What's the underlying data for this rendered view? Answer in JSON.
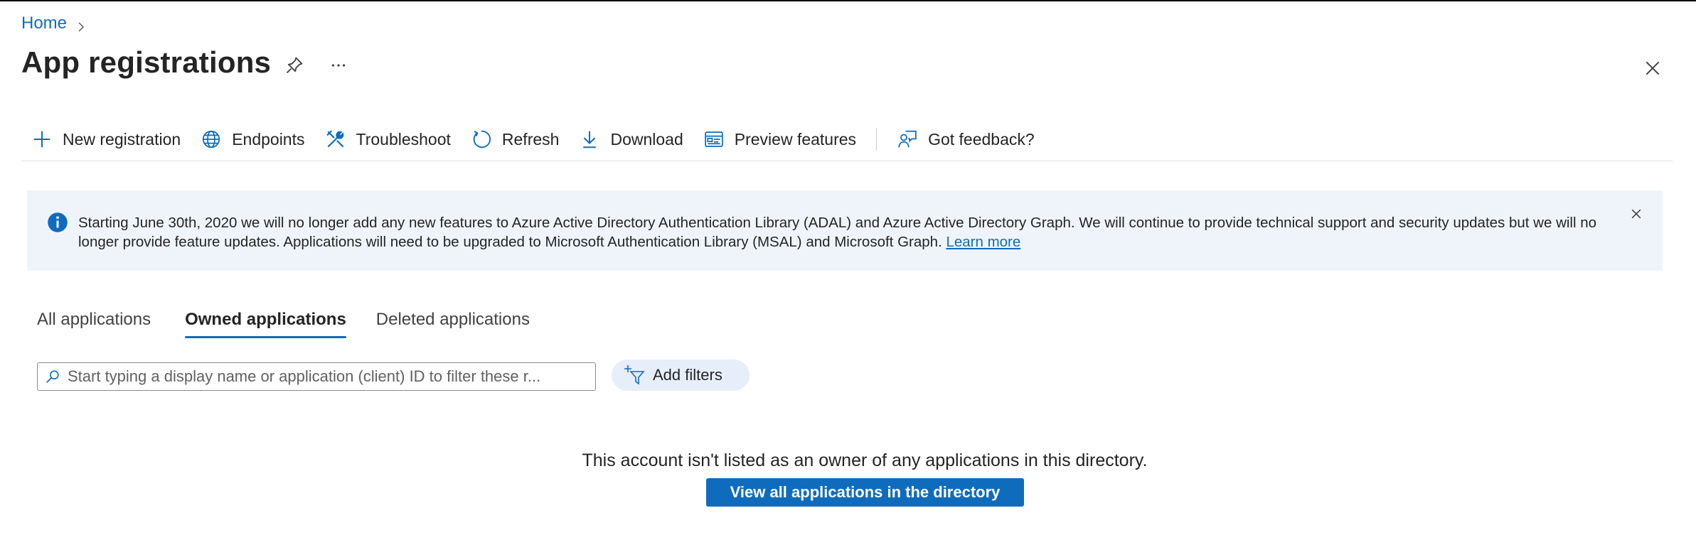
{
  "breadcrumb": {
    "home": "Home"
  },
  "page": {
    "title": "App registrations"
  },
  "toolbar": {
    "new_registration": "New registration",
    "endpoints": "Endpoints",
    "troubleshoot": "Troubleshoot",
    "refresh": "Refresh",
    "download": "Download",
    "preview_features": "Preview features",
    "feedback": "Got feedback?"
  },
  "banner": {
    "text": "Starting June 30th, 2020 we will no longer add any new features to Azure Active Directory Authentication Library (ADAL) and Azure Active Directory Graph. We will continue to provide technical support and security updates but we will no longer provide feature updates. Applications will need to be upgraded to Microsoft Authentication Library (MSAL) and Microsoft Graph.",
    "link": "Learn more"
  },
  "tabs": {
    "all": "All applications",
    "owned": "Owned applications",
    "deleted": "Deleted applications"
  },
  "search": {
    "placeholder": "Start typing a display name or application (client) ID to filter these r...",
    "value": ""
  },
  "filters": {
    "add_label": "Add filters"
  },
  "empty_state": {
    "message": "This account isn't listed as an owner of any applications in this directory.",
    "button": "View all applications in the directory"
  },
  "colors": {
    "accent": "#0f6cbd",
    "banner_bg": "#eff4fb",
    "filter_pill_bg": "#e6eef9"
  }
}
